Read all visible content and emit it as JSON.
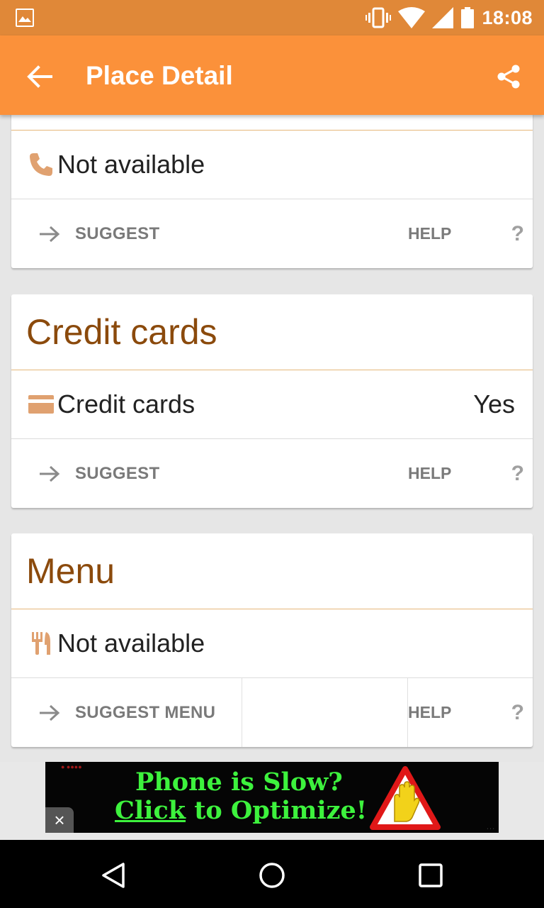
{
  "status_bar": {
    "time": "18:08",
    "icons": [
      "picture-icon",
      "vibrate-icon",
      "wifi-icon",
      "signal-icon",
      "battery-icon"
    ],
    "color": "#e08838"
  },
  "app_bar": {
    "title": "Place Detail",
    "color": "#fb913a"
  },
  "cards": {
    "phone": {
      "icon": "phone-icon",
      "text": "Not available",
      "suggest": "SUGGEST",
      "help": "HELP",
      "help_mark": "?"
    },
    "credit": {
      "title": "Credit cards",
      "icon": "credit-card-icon",
      "label": "Credit cards",
      "value": "Yes",
      "suggest": "SUGGEST",
      "help": "HELP",
      "help_mark": "?"
    },
    "menu": {
      "title": "Menu",
      "icon": "fork-knife-icon",
      "text": "Not available",
      "suggest": "SUGGEST MENU",
      "help": "HELP",
      "help_mark": "?"
    }
  },
  "ad": {
    "line1": "Phone is Slow?",
    "line2_click": "Click",
    "line2_rest": "to Optimize!",
    "close": "×",
    "text_color": "#3df23d"
  },
  "nav_bar": {
    "buttons": [
      "back-triangle-icon",
      "home-circle-icon",
      "recents-square-icon"
    ]
  },
  "theme": {
    "title_color": "#8b4a0c",
    "icon_color": "#e0a170",
    "action_color": "#7a7a7a"
  }
}
